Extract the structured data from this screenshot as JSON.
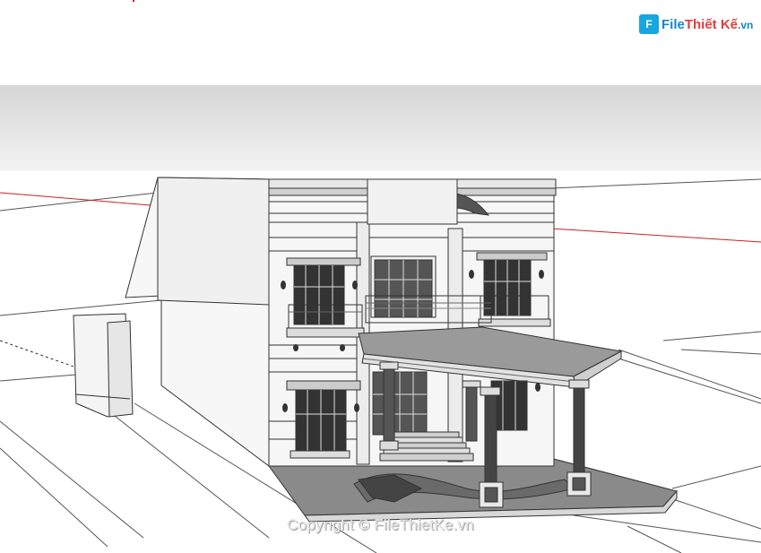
{
  "logo": {
    "part1": "File",
    "part2": "Thiết Kế",
    "part3": ".vn"
  },
  "watermark": "Copyright © FileThietKe.vn",
  "colors": {
    "sky_top": "#d6d6d6",
    "sky_bottom": "#f3f3f3",
    "axis_red": "#cc2222",
    "brand_blue": "#1487c9",
    "brand_red": "#e23c3c"
  }
}
